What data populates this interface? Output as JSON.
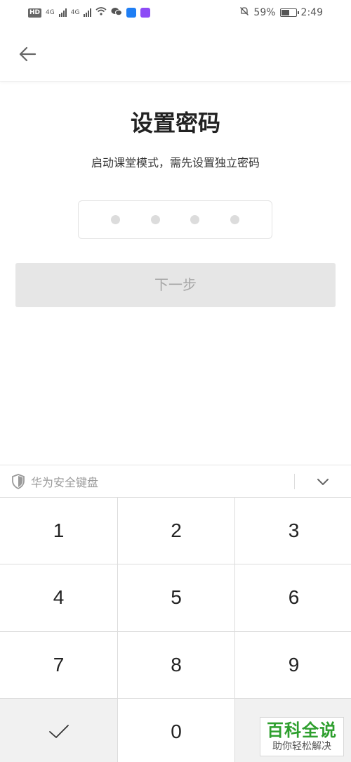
{
  "status_bar": {
    "hd": "HD",
    "network_1": "4G",
    "network_2": "4G",
    "battery_percent": "59%",
    "battery_level": 0.59,
    "time": "2:49",
    "app_colors": [
      "#1f7ef4",
      "#8d4bf6"
    ]
  },
  "header": {
    "back_icon": "arrow-left-icon"
  },
  "main": {
    "title": "设置密码",
    "subtitle": "启动课堂模式，需先设置独立密码",
    "pin_length": 4,
    "next_label": "下一步"
  },
  "keyboard": {
    "title": "华为安全键盘",
    "shield_icon": "shield-icon",
    "collapse_icon": "chevron-down-icon",
    "keys": [
      "1",
      "2",
      "3",
      "4",
      "5",
      "6",
      "7",
      "8",
      "9",
      "",
      "0",
      ""
    ],
    "confirm_icon": "checkmark-icon"
  },
  "watermark": {
    "main": "百科全说",
    "sub": "助你轻松解决"
  }
}
